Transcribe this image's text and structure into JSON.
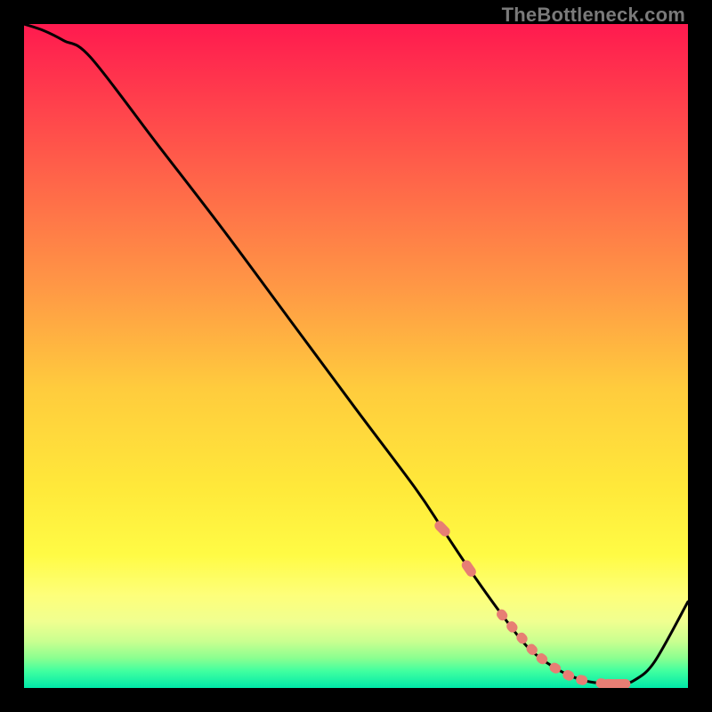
{
  "watermark": "TheBottleneck.com",
  "colors": {
    "curve": "#000000",
    "marker": "#e77e74",
    "background": "#000000",
    "gradient_stops": [
      {
        "offset": 0,
        "color": "#ff1a4f"
      },
      {
        "offset": 0.2,
        "color": "#ff5a4a"
      },
      {
        "offset": 0.4,
        "color": "#ff9945"
      },
      {
        "offset": 0.55,
        "color": "#ffcc3d"
      },
      {
        "offset": 0.7,
        "color": "#ffe93a"
      },
      {
        "offset": 0.8,
        "color": "#fffb45"
      },
      {
        "offset": 0.86,
        "color": "#feff7a"
      },
      {
        "offset": 0.9,
        "color": "#f0ff90"
      },
      {
        "offset": 0.93,
        "color": "#c9ff90"
      },
      {
        "offset": 0.955,
        "color": "#8bff90"
      },
      {
        "offset": 0.975,
        "color": "#3fffa0"
      },
      {
        "offset": 1.0,
        "color": "#00e8a8"
      }
    ]
  },
  "chart_data": {
    "type": "line",
    "title": "",
    "xlabel": "",
    "ylabel": "",
    "xlim": [
      0,
      100
    ],
    "ylim": [
      0,
      100
    ],
    "grid": false,
    "legend": false,
    "series": [
      {
        "name": "bottleneck-curve",
        "x": [
          0,
          3,
          6,
          10,
          20,
          30,
          40,
          50,
          59,
          63,
          67,
          72,
          76,
          80,
          84,
          88,
          90,
          92,
          95,
          100
        ],
        "y": [
          100,
          99,
          97.5,
          95,
          82,
          69,
          55.5,
          42,
          30,
          24,
          18,
          11,
          6,
          3,
          1.2,
          0.6,
          0.6,
          1.2,
          4,
          13
        ]
      }
    ],
    "markers": {
      "name": "highlighted-points",
      "x": [
        63,
        67,
        72,
        73.5,
        75,
        76.5,
        78,
        80,
        82,
        84,
        87,
        88.5,
        90
      ],
      "y": [
        24,
        18,
        11,
        9.2,
        7.5,
        5.8,
        4.4,
        3.0,
        1.9,
        1.2,
        0.7,
        0.6,
        0.6
      ]
    }
  }
}
